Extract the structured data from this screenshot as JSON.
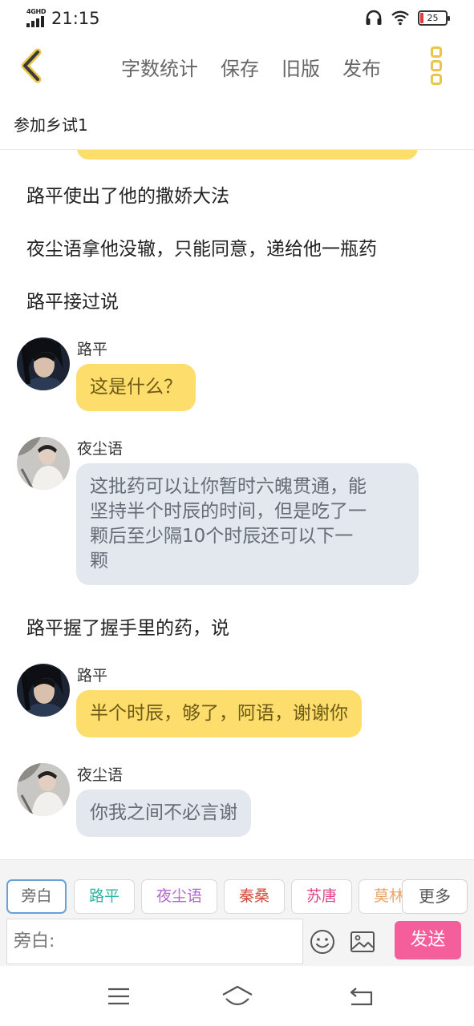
{
  "status_bar": {
    "network": "4GHD",
    "time": "21:15",
    "battery_level": "25",
    "icons": [
      "signal-icon",
      "headphones-icon",
      "wifi-icon",
      "battery-icon"
    ]
  },
  "toolbar": {
    "back_icon": "chevron-left-icon",
    "word_count": "字数统计",
    "save": "保存",
    "old_version": "旧版",
    "publish": "发布",
    "more_icon": "vertical-dots-icon"
  },
  "document": {
    "title": "参加乡试1"
  },
  "story": {
    "narration1": "路平使出了他的撒娇大法",
    "narration2": "夜尘语拿他没辙，只能同意，递给他一瓶药",
    "narration3": "路平接过说",
    "msg1": {
      "speaker": "路平",
      "text": "这是什么？"
    },
    "msg2": {
      "speaker": "夜尘语",
      "lines": [
        "这批药可以让你暂时六魄贯通，能",
        "坚持半个时辰的时间，但是吃了一",
        "颗后至少隔10个时辰还可以下一",
        "颗"
      ]
    },
    "narration4": "路平握了握手里的药，说",
    "msg3": {
      "speaker": "路平",
      "text": "半个时辰，够了，阿语，谢谢你"
    },
    "msg4": {
      "speaker": "夜尘语",
      "text": "你我之间不必言谢"
    }
  },
  "characters": {
    "chips": [
      {
        "label": "旁白",
        "color": "#666666"
      },
      {
        "label": "路平",
        "color": "#2bb5a6"
      },
      {
        "label": "夜尘语",
        "color": "#b067c9"
      },
      {
        "label": "秦桑",
        "color": "#d44a3a"
      },
      {
        "label": "苏唐",
        "color": "#e0458c"
      },
      {
        "label": "莫林",
        "color": "#e8a56a"
      }
    ],
    "more": "更多"
  },
  "composer": {
    "placeholder": "旁白:",
    "emoji_icon": "emoji-icon",
    "image_icon": "image-icon",
    "send": "发送",
    "send_color": "#f45e9b"
  },
  "nav_bar": {
    "icons": [
      "menu-icon",
      "home-icon",
      "back-icon"
    ]
  }
}
